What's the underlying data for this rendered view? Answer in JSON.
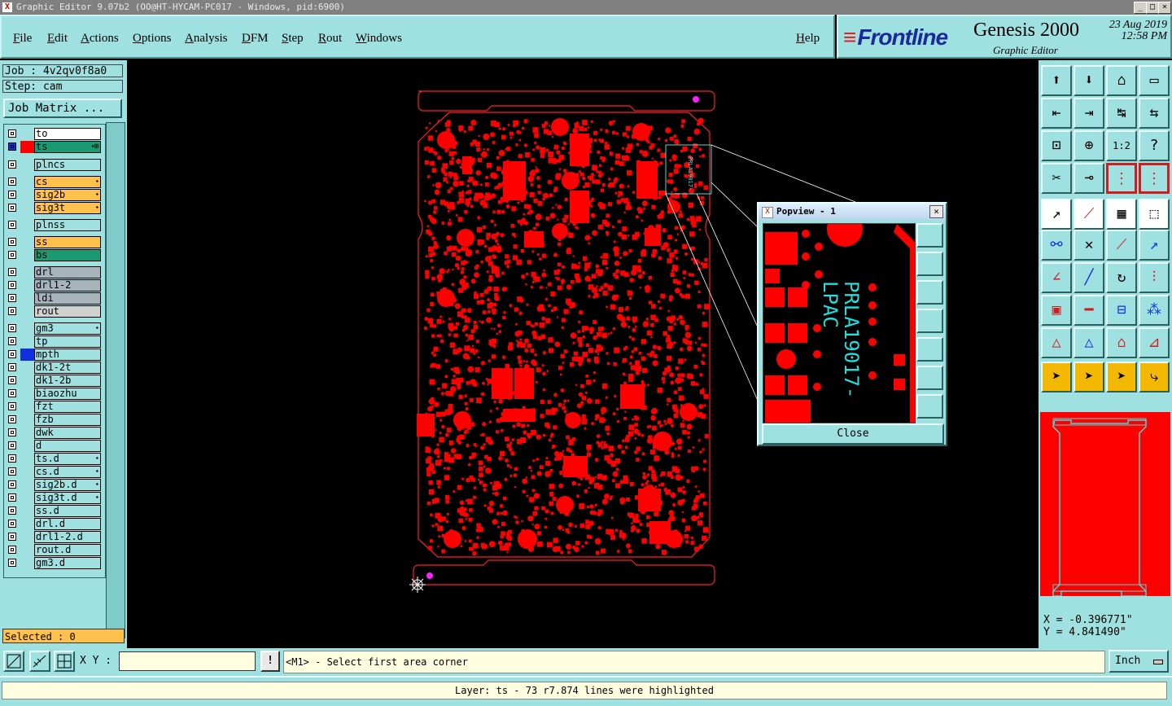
{
  "window": {
    "title": "Graphic Editor 9.07b2 (OO@HT-HYCAM-PC017 - Windows, pid:6900)",
    "minimize": "_",
    "maximize": "□",
    "close": "×"
  },
  "menu": {
    "items": [
      "File",
      "Edit",
      "Actions",
      "Options",
      "Analysis",
      "DFM",
      "Step",
      "Rout",
      "Windows"
    ],
    "help": "Help"
  },
  "brand": {
    "logo": "Frontline",
    "product": "Genesis 2000",
    "subtitle": "Graphic Editor",
    "date": "23 Aug 2019",
    "time": "12:58 PM"
  },
  "job": {
    "job_label": "Job : 4v2qv0f8a0",
    "step_label": "Step: cam",
    "matrix_button": "Job Matrix ..."
  },
  "layers": [
    {
      "name": "to",
      "bg": "#ffffff",
      "swatch": "",
      "mark": ""
    },
    {
      "name": "ts",
      "bg": "#1a9a70",
      "swatch": "#ff0000",
      "mark": "⬩⊞",
      "active": true
    },
    {
      "name": "plncs",
      "bg": "#9fe0e0",
      "swatch": "",
      "mark": ""
    },
    {
      "name": "cs",
      "bg": "#ffc04c",
      "swatch": "",
      "mark": "⬩"
    },
    {
      "name": "sig2b",
      "bg": "#ffc04c",
      "swatch": "",
      "mark": "⬩"
    },
    {
      "name": "sig3t",
      "bg": "#ffc04c",
      "swatch": "",
      "mark": "⬩"
    },
    {
      "name": "plnss",
      "bg": "#9fe0e0",
      "swatch": "",
      "mark": ""
    },
    {
      "name": "ss",
      "bg": "#ffc04c",
      "swatch": "",
      "mark": ""
    },
    {
      "name": "bs",
      "bg": "#1a9a70",
      "swatch": "",
      "mark": ""
    },
    {
      "name": "drl",
      "bg": "#a8b4bc",
      "swatch": "",
      "mark": ""
    },
    {
      "name": "drl1-2",
      "bg": "#a8b4bc",
      "swatch": "",
      "mark": ""
    },
    {
      "name": "ldi",
      "bg": "#a8b4bc",
      "swatch": "",
      "mark": ""
    },
    {
      "name": "rout",
      "bg": "#d0d0d0",
      "swatch": "",
      "mark": ""
    },
    {
      "name": "gm3",
      "bg": "#9fe0e0",
      "swatch": "",
      "mark": "⬩"
    },
    {
      "name": "tp",
      "bg": "#9fe0e0",
      "swatch": "",
      "mark": ""
    },
    {
      "name": "mpth",
      "bg": "#9fe0e0",
      "swatch": "#1030e0",
      "mark": ""
    },
    {
      "name": "dk1-2t",
      "bg": "#9fe0e0",
      "swatch": "",
      "mark": ""
    },
    {
      "name": "dk1-2b",
      "bg": "#9fe0e0",
      "swatch": "",
      "mark": ""
    },
    {
      "name": "biaozhu",
      "bg": "#9fe0e0",
      "swatch": "",
      "mark": ""
    },
    {
      "name": "fzt",
      "bg": "#9fe0e0",
      "swatch": "",
      "mark": ""
    },
    {
      "name": "fzb",
      "bg": "#9fe0e0",
      "swatch": "",
      "mark": ""
    },
    {
      "name": "dwk",
      "bg": "#9fe0e0",
      "swatch": "",
      "mark": ""
    },
    {
      "name": "d",
      "bg": "#9fe0e0",
      "swatch": "",
      "mark": ""
    },
    {
      "name": "ts.d",
      "bg": "#9fe0e0",
      "swatch": "",
      "mark": "⬩"
    },
    {
      "name": "cs.d",
      "bg": "#9fe0e0",
      "swatch": "",
      "mark": "⬩"
    },
    {
      "name": "sig2b.d",
      "bg": "#9fe0e0",
      "swatch": "",
      "mark": "⬩"
    },
    {
      "name": "sig3t.d",
      "bg": "#9fe0e0",
      "swatch": "",
      "mark": "⬩"
    },
    {
      "name": "ss.d",
      "bg": "#9fe0e0",
      "swatch": "",
      "mark": ""
    },
    {
      "name": "drl.d",
      "bg": "#9fe0e0",
      "swatch": "",
      "mark": ""
    },
    {
      "name": "drl1-2.d",
      "bg": "#9fe0e0",
      "swatch": "",
      "mark": ""
    },
    {
      "name": "rout.d",
      "bg": "#9fe0e0",
      "swatch": "",
      "mark": ""
    },
    {
      "name": "gm3.d",
      "bg": "#9fe0e0",
      "swatch": "",
      "mark": ""
    }
  ],
  "selected": "Selected : 0",
  "bottom": {
    "xy_label": "X Y :",
    "xy_value": "",
    "bang": "!",
    "prompt": "<M1> - Select first area corner",
    "unit": "Inch"
  },
  "status": "Layer: ts - 73 r7.874 lines were highlighted",
  "coords": {
    "x": "X = -0.396771\"",
    "y": "Y = 4.841490\""
  },
  "popview": {
    "title": "Popview - 1",
    "close_label": "Close",
    "board_text_1": "PRLA19017-",
    "board_text_2": "LPAC"
  },
  "colors": {
    "panel": "#9fe0e0",
    "board": "#ff0000",
    "text_cyan": "#20e0e0",
    "highlight": "#ffc04c"
  }
}
